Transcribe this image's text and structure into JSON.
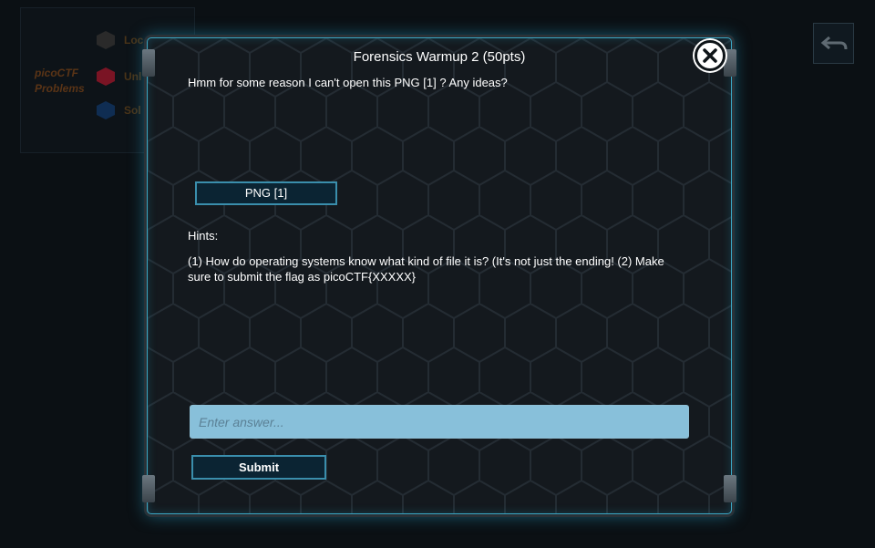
{
  "background": {
    "title_line1": "picoCTF",
    "title_line2": "Problems",
    "items": [
      {
        "label": "Loc",
        "color": "#2a2a2a"
      },
      {
        "label": "Unl",
        "color": "#7a1424"
      },
      {
        "label": "Sol",
        "color": "#0f2d52"
      }
    ]
  },
  "modal": {
    "title": "Forensics Warmup 2 (50pts)",
    "description": "Hmm for some reason I can't open this PNG [1] ? Any ideas?",
    "file_button_label": "PNG [1]",
    "hints_label": "Hints:",
    "hints_text": "(1) How do operating systems know what kind of file it is? (It's not just the ending! (2) Make sure to submit the flag as picoCTF{XXXXX}",
    "answer_placeholder": "Enter answer...",
    "answer_value": "",
    "submit_label": "Submit"
  },
  "colors": {
    "accent": "#3aa7c4",
    "button_bg": "#0b2433",
    "input_bg": "#88c0da"
  },
  "icons": {
    "close": "close-icon",
    "back": "back-arrow-icon"
  }
}
